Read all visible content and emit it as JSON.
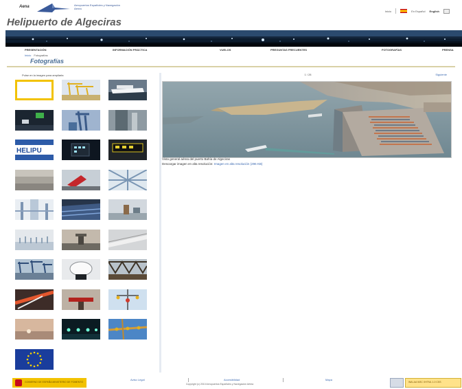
{
  "header": {
    "brand": "Aena",
    "org_name": "Aeropuertos Españoles y Navegación Aérea",
    "toplinks": {
      "home": "Inicio",
      "spanish_label": "En Español",
      "english_label": "English"
    },
    "site_title": "Helipuerto de Algeciras"
  },
  "nav": {
    "items": [
      "PRESENTACIÓN",
      "INFORMACIÓN PRÁCTICA",
      "VUELOS",
      "PREGUNTAS FRECUENTES",
      "FOTOGRAFÍAS",
      "PRENSA"
    ]
  },
  "breadcrumb": {
    "home": "Inicio",
    "current": "Fotografías"
  },
  "section_title": "Fotografías",
  "gallery": {
    "instruction": "Pulse en la imagen para ampliarla",
    "thumbnails": [
      {
        "name": "thumb-selected",
        "theme": "selected"
      },
      {
        "name": "thumb-cranes",
        "theme": "cranes"
      },
      {
        "name": "thumb-ship",
        "theme": "ship"
      },
      {
        "name": "thumb-sign-green",
        "theme": "sign"
      },
      {
        "name": "thumb-crane-blue",
        "theme": "craneblue"
      },
      {
        "name": "thumb-tower-grey",
        "theme": "towergrey"
      },
      {
        "name": "thumb-heli-text",
        "theme": "helitext"
      },
      {
        "name": "thumb-panel-lights",
        "theme": "panel"
      },
      {
        "name": "thumb-panel-yellow",
        "theme": "panelyellow"
      },
      {
        "name": "thumb-wall",
        "theme": "wall"
      },
      {
        "name": "thumb-windsock",
        "theme": "windsock"
      },
      {
        "name": "thumb-structure",
        "theme": "structure"
      },
      {
        "name": "thumb-pylons",
        "theme": "pylons"
      },
      {
        "name": "thumb-building-blue",
        "theme": "buildingblue"
      },
      {
        "name": "thumb-port-view",
        "theme": "port"
      },
      {
        "name": "thumb-haze",
        "theme": "haze"
      },
      {
        "name": "thumb-tower-dusk",
        "theme": "towerdusk"
      },
      {
        "name": "thumb-beam",
        "theme": "beam"
      },
      {
        "name": "thumb-cranes-blue",
        "theme": "cranesblue"
      },
      {
        "name": "thumb-dish",
        "theme": "dish"
      },
      {
        "name": "thumb-truss",
        "theme": "truss"
      },
      {
        "name": "thumb-orange-rails",
        "theme": "orangerails"
      },
      {
        "name": "thumb-red-fixture",
        "theme": "redfixture"
      },
      {
        "name": "thumb-lamp-pole",
        "theme": "lamppole"
      },
      {
        "name": "thumb-sunset",
        "theme": "sunset"
      },
      {
        "name": "thumb-lights-night",
        "theme": "lightsnight"
      },
      {
        "name": "thumb-sky-structure",
        "theme": "skystructure"
      },
      {
        "name": "thumb-eu-flag",
        "theme": "euflag"
      }
    ]
  },
  "viewer": {
    "counter": "1 / 28",
    "next_label": "Siguiente",
    "caption": "Vista general aérea del puerto Bahía de Algeciras",
    "download_prefix": "Descargar imagen en alta resolución:",
    "download_link": "Imagen en alta resolución (296 KB)"
  },
  "footer": {
    "gob_text": "GOBIERNO DE ESPAÑA  MINISTERIO DE FOMENTO",
    "links": [
      "Aviso Legal",
      "Accesibilidad",
      "Mapa"
    ],
    "copyright": "Copyright (c) 2010 Aeropuertos Españoles y Navegación Aérea",
    "badge_text": "WAI-AA  W3C XHTML 1.0  CSS"
  },
  "colors": {
    "title_blue": "#4b6f96",
    "link_blue": "#3a68b0",
    "selected_border": "#f2c200",
    "rule": "#d9d1a6"
  }
}
